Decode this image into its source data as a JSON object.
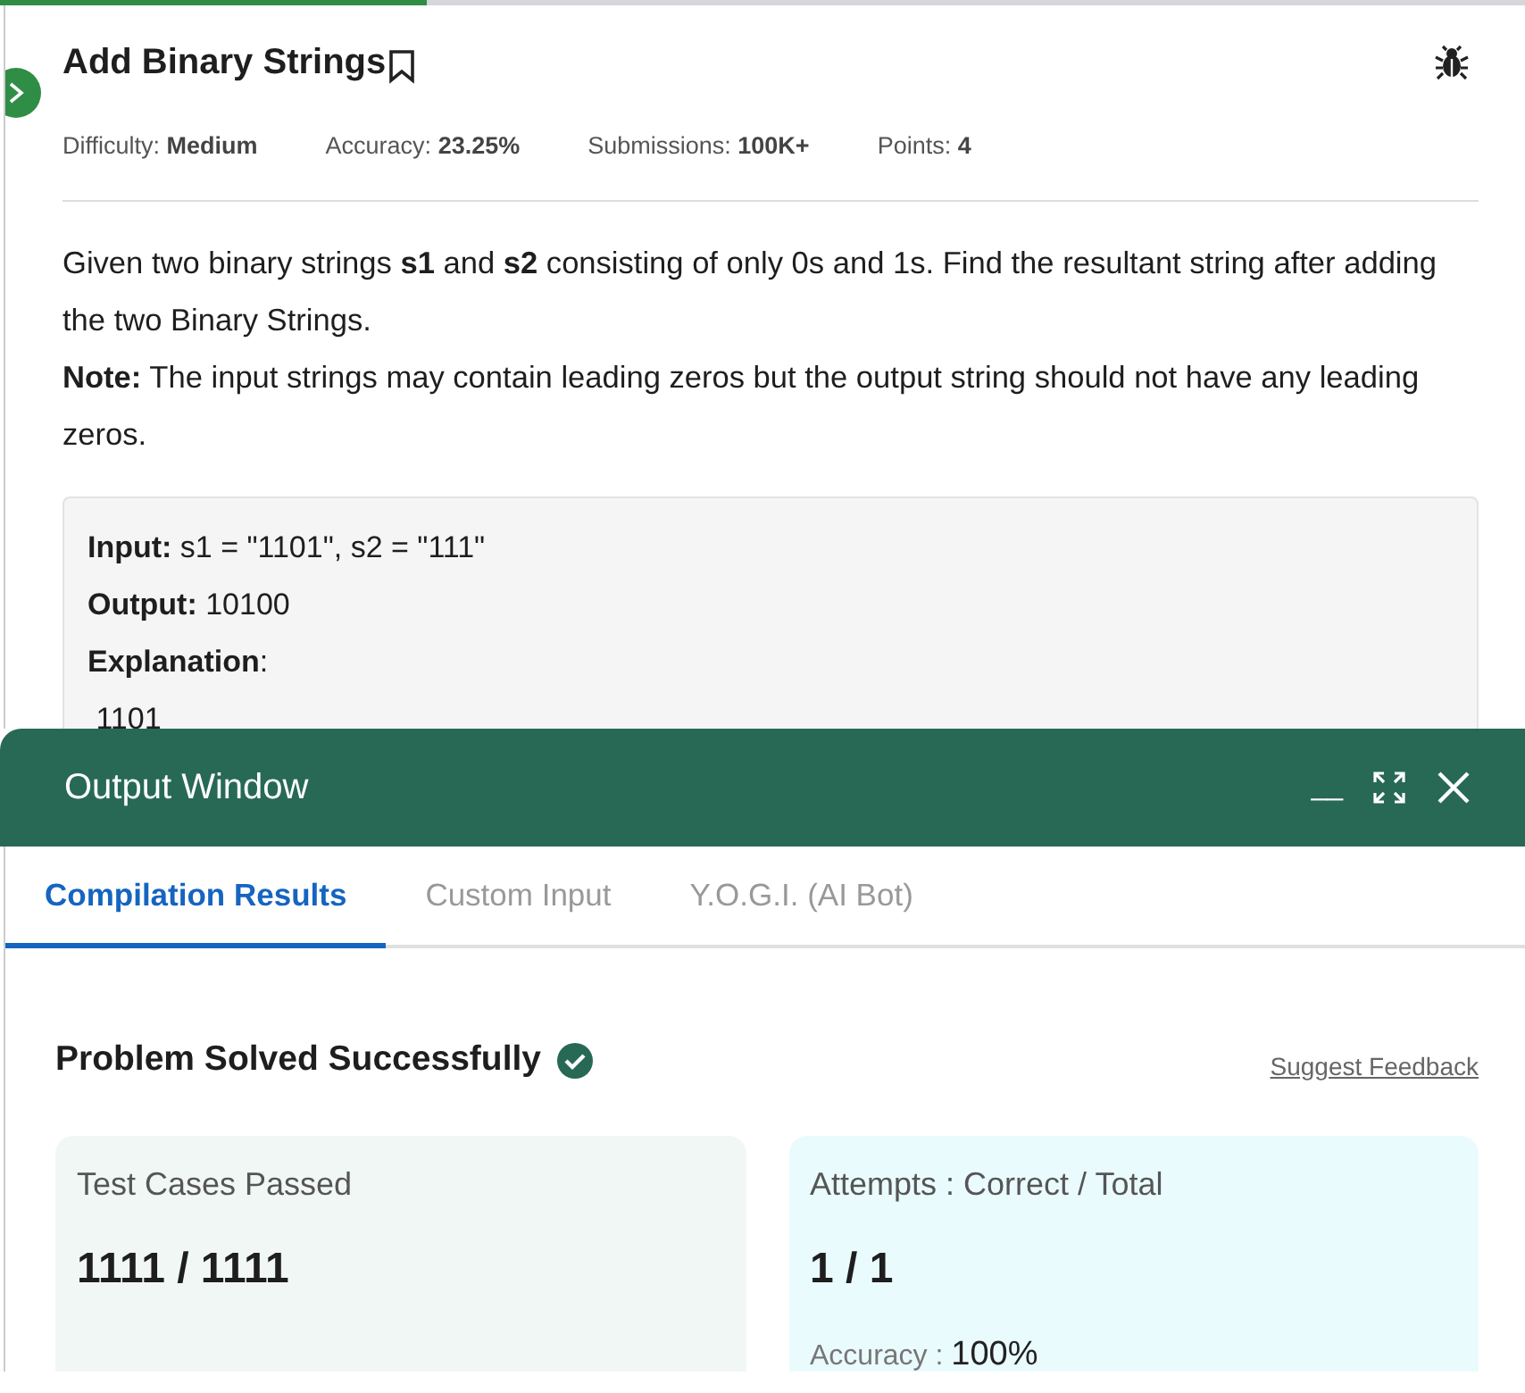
{
  "progress": {
    "level": 0.28
  },
  "problem": {
    "title": "Add Binary Strings",
    "meta": [
      {
        "label": "Difficulty:",
        "value": "Medium"
      },
      {
        "label": "Accuracy:",
        "value": "23.25%"
      },
      {
        "label": "Submissions:",
        "value": "100K+"
      },
      {
        "label": "Points:",
        "value": "4"
      }
    ],
    "paragraphs": [
      "Given two binary strings **s1** and **s2** consisting of only 0s and 1s. Find the resultant string after adding the two Binary Strings.",
      "**Note:** The input strings may contain leading zeros but the output string should not have any leading zeros."
    ],
    "example": [
      {
        "label": "Input:",
        "value": " s1 = \"1101\", s2 = \"111\""
      },
      {
        "label": "Output:",
        "value": " 10100"
      },
      {
        "label": "Explanation",
        "value": ":"
      },
      {
        "value": " 1101"
      }
    ]
  },
  "output_window": {
    "title": "Output Window",
    "minimize": "__",
    "tabs": [
      {
        "label": "Compilation Results",
        "selected": true
      },
      {
        "label": "Custom Input",
        "selected": false
      },
      {
        "label": "Y.O.G.I. (AI Bot)",
        "selected": false
      }
    ],
    "status": "Problem Solved Successfully",
    "feedback_link": "Suggest Feedback",
    "cards": [
      {
        "label": "Test Cases Passed",
        "value": "1111 / 1111"
      },
      {
        "label": "Attempts : Correct / Total",
        "value": "1 / 1",
        "extra_label": "Accuracy :",
        "extra_value": "100%"
      }
    ]
  }
}
